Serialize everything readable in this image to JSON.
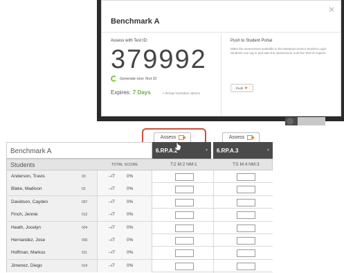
{
  "modal": {
    "title": "Benchmark A",
    "close_icon": "close-icon",
    "left_heading": "Assess with Test ID:",
    "test_id": "379992",
    "generate_label": "Generate new Test ID",
    "expires_label": "Expires:",
    "expires_value": "7 Days",
    "change_link": "• change expiration options",
    "right_heading": "Push to Student Portal",
    "push_description": "Make the assessment available in the MasteryConnect Student Login. Students can log in and take the assessment until the Test ID expires.",
    "push_button": "Push"
  },
  "assess_buttons": [
    {
      "label": "Assess"
    },
    {
      "label": "Assess"
    }
  ],
  "table": {
    "title": "Benchmark A",
    "standards": [
      "6.RP.A.2",
      "6.RP.A.3"
    ],
    "students_header": "Students",
    "total_header": "TOTAL SCORE",
    "standard_subheads": [
      "T:2  M:2  NM:1",
      "T:5  M:4  NM:3"
    ],
    "rows": [
      {
        "name": "Anderson, Travis",
        "id": "03",
        "score": "–/7",
        "pct": "0%"
      },
      {
        "name": "Blake, Madison",
        "id": "02",
        "score": "–/7",
        "pct": "0%"
      },
      {
        "name": "Davidson, Cayden",
        "id": "007",
        "score": "–/7",
        "pct": "0%"
      },
      {
        "name": "Finch, Jennie",
        "id": "012",
        "score": "–/7",
        "pct": "0%"
      },
      {
        "name": "Heath, Jocelyn",
        "id": "004",
        "score": "–/7",
        "pct": "0%"
      },
      {
        "name": "Hernandez, Jose",
        "id": "006",
        "score": "–/7",
        "pct": "0%"
      },
      {
        "name": "Hoffman, Markus",
        "id": "011",
        "score": "–/7",
        "pct": "0%"
      },
      {
        "name": "Jimenez, Diego",
        "id": "014",
        "score": "–/7",
        "pct": "0%"
      }
    ]
  },
  "colors": {
    "accent_orange": "#e8833a",
    "highlight_red": "#c9513a",
    "expire_green": "#6aa84f",
    "header_dark": "#4a4a4a"
  }
}
